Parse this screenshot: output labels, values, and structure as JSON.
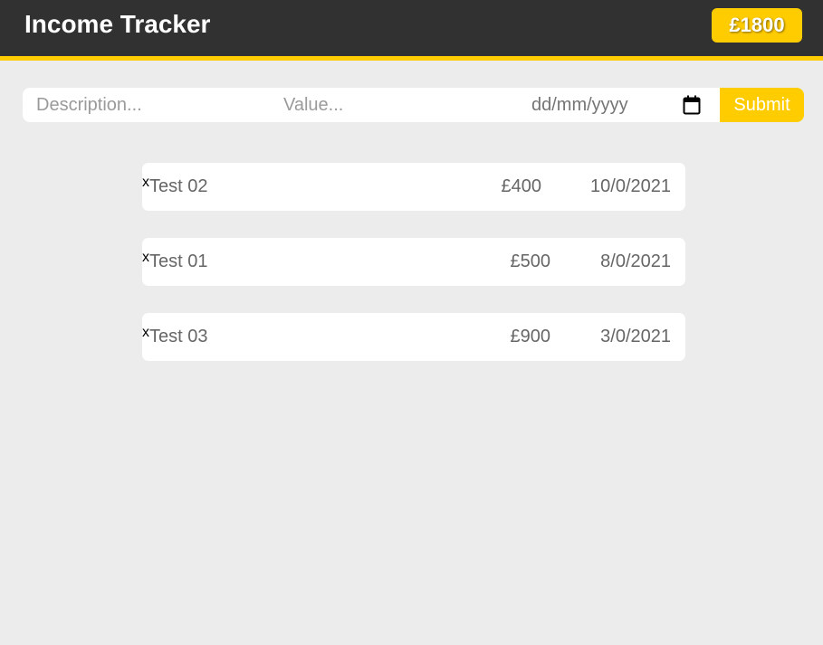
{
  "header": {
    "title": "Income Tracker",
    "total": "£1800"
  },
  "form": {
    "description_placeholder": "Description...",
    "value_placeholder": "Value...",
    "date_placeholder": "dd/mm/yyyy",
    "calendar_icon": "calendar-icon",
    "submit_label": "Submit"
  },
  "income_list": [
    {
      "delete_label": "x",
      "description": "Test 02",
      "amount": "£400",
      "date": "10/0/2021"
    },
    {
      "delete_label": "x",
      "description": "Test 01",
      "amount": "£500",
      "date": "8/0/2021"
    },
    {
      "delete_label": "x",
      "description": "Test 03",
      "amount": "£900",
      "date": "3/0/2021"
    }
  ],
  "colors": {
    "header_bg": "#313131",
    "accent": "#ffcc00",
    "page_bg": "#ececec"
  }
}
